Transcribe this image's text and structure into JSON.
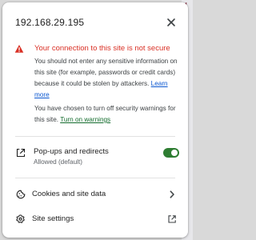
{
  "header": {
    "address": "192.168.29.195"
  },
  "security": {
    "title": "Your connection to this site is not secure",
    "body": "You should not enter any sensitive information on this site (for example, passwords or credit cards) because it could be stolen by attackers.",
    "learn_more": "Learn more",
    "chosen_text": "You have chosen to turn off security warnings for this site.",
    "turn_on_warnings": "Turn on warnings"
  },
  "permissions": {
    "popups": {
      "label": "Pop-ups and redirects",
      "status": "Allowed (default)",
      "enabled": true
    }
  },
  "menu": {
    "cookies": "Cookies and site data",
    "site_settings": "Site settings"
  },
  "icons": {
    "close": "close-icon",
    "warning": "warning-icon",
    "popup": "open-in-new-window-icon",
    "cookie": "cookie-icon",
    "chevron": "chevron-right-icon",
    "gear": "gear-icon",
    "external": "external-link-icon"
  },
  "colors": {
    "danger": "#d93025",
    "link": "#0b57d0",
    "link_green": "#146c2e",
    "toggle_on": "#2e7d32"
  }
}
